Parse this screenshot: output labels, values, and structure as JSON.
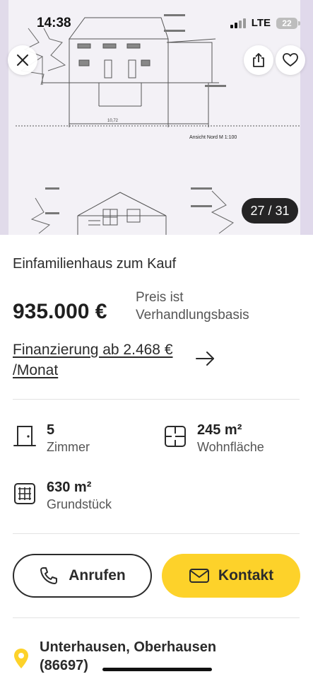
{
  "status_bar": {
    "time": "14:38",
    "network": "LTE",
    "battery": "22"
  },
  "hero": {
    "image_caption": "Ansicht Nord M 1:100",
    "dimension_label": "10,72",
    "counter": "27 / 31",
    "icons": {
      "close": "close-icon",
      "share": "share-icon",
      "favorite": "heart-icon"
    }
  },
  "listing": {
    "title": "Einfamilienhaus zum Kauf",
    "price": "935.000 €",
    "price_note": "Preis ist Verhandlungsbasis",
    "financing": "Finanzierung ab 2.468 € /Monat"
  },
  "facts": [
    {
      "value": "5",
      "label": "Zimmer",
      "icon": "door-icon"
    },
    {
      "value": "245 m²",
      "label": "Wohnfläche",
      "icon": "floorplan-icon"
    },
    {
      "value": "630 m²",
      "label": "Grundstück",
      "icon": "grid-icon"
    }
  ],
  "actions": {
    "call_label": "Anrufen",
    "contact_label": "Kontakt"
  },
  "location": {
    "text": "Unterhausen, Oberhausen (86697)"
  },
  "colors": {
    "accent": "#fdd22a",
    "text": "#2b2b2b"
  }
}
